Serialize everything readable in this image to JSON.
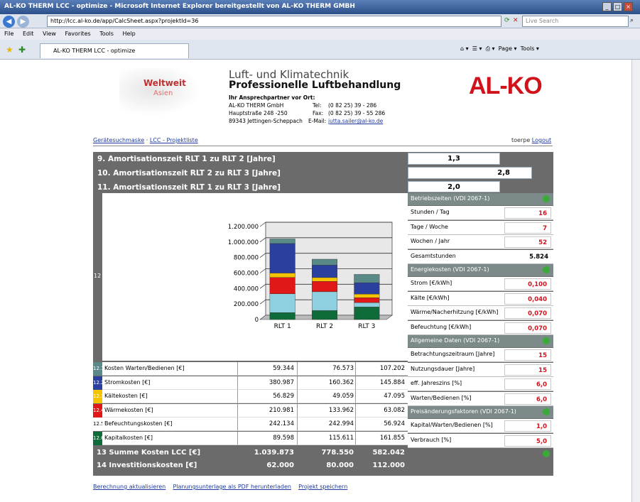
{
  "window": {
    "title": "AL-KO THERM LCC - optimize - Microsoft Internet Explorer bereitgestellt von AL-KO THERM GMBH"
  },
  "browser": {
    "url": "http://lcc.al-ko.de/app/CalcSheet.aspx?projektId=36",
    "search_placeholder": "Live Search",
    "menu": [
      "File",
      "Edit",
      "View",
      "Favorites",
      "Tools",
      "Help"
    ],
    "tab_label": "AL-KO THERM LCC - optimize",
    "toolbar": [
      "Page",
      "Tools"
    ]
  },
  "header": {
    "map_title": "Weltweit",
    "map_sub": "Asien",
    "tagline1": "Luft- und Klimatechnik",
    "tagline2": "Professionelle Luftbehandlung",
    "contact_heading": "Ihr Ansprechpartner vor Ort:",
    "company": "AL-KO THERM GmbH",
    "street": "Hauptstraße 248 -250",
    "city": "89343 Jettingen-Scheppach",
    "tel_label": "Tel:",
    "tel": "(0 82 25) 39 - 286",
    "fax_label": "Fax:",
    "fax": "(0 82 25) 39 - 55 286",
    "email_label": "E-Mail:",
    "email": "jutta.sailer@al-ko.de",
    "logo": "AL-KO"
  },
  "nav": {
    "link1": "Gerätesuchmaske",
    "sep": "·",
    "link2": "LCC - Projektliste",
    "user": "toerpe",
    "logout": "Logout"
  },
  "rows": {
    "r9": {
      "label": "9.   Amortisationszeit RLT 1 zu RLT 2 [Jahre]",
      "value": "1,3"
    },
    "r10": {
      "label": "10.  Amortisationszeit RLT 2 zu RLT 3 [Jahre]",
      "value": "2,8"
    },
    "r11": {
      "label": "11.  Amortisationszeit RLT 1 zu RLT 3 [Jahre]",
      "value": "2,0"
    },
    "r12_num": "12"
  },
  "chart_data": {
    "type": "bar",
    "stacked": true,
    "categories": [
      "RLT 1",
      "RLT 2",
      "RLT 3"
    ],
    "ylim": [
      0,
      1200000
    ],
    "yticks": [
      "0",
      "200.000",
      "400.000",
      "600.000",
      "800.000",
      "1.000.000",
      "1.200.000"
    ],
    "grid": true,
    "series": [
      {
        "color": "#0f6b3a",
        "values": [
          89598,
          115611,
          161855
        ]
      },
      {
        "color": "#8fd0e0",
        "values": [
          242134,
          242994,
          56924
        ]
      },
      {
        "color": "#e01818",
        "values": [
          210981,
          133962,
          63082
        ]
      },
      {
        "color": "#f4c400",
        "values": [
          56829,
          49059,
          47095
        ]
      },
      {
        "color": "#2a3f9e",
        "values": [
          380987,
          160362,
          145884
        ]
      },
      {
        "color": "#5a8a88",
        "values": [
          59344,
          76573,
          107202
        ]
      }
    ]
  },
  "cost_table": {
    "rows": [
      {
        "num": "12.1",
        "label": "Kosten Warten/Bedienen [€]",
        "color": "#5a8a88",
        "v": [
          "59.344",
          "76.573",
          "107.202"
        ]
      },
      {
        "num": "12.2",
        "label": "Stromkosten [€]",
        "color": "#2a3f9e",
        "v": [
          "380.987",
          "160.362",
          "145.884"
        ]
      },
      {
        "num": "12.3",
        "label": "Kältekosten [€]",
        "color": "#f4c400",
        "v": [
          "56.829",
          "49.059",
          "47.095"
        ]
      },
      {
        "num": "12.4",
        "label": "Wärmekosten [€]",
        "color": "#e01818",
        "v": [
          "210.981",
          "133.962",
          "63.082"
        ]
      },
      {
        "num": "12.5",
        "label": "Befeuchtungskosten [€]",
        "color": "#ffffff",
        "v": [
          "242.134",
          "242.994",
          "56.924"
        ]
      },
      {
        "num": "12.6",
        "label": "Kapitalkosten [€]",
        "color": "#0f6b3a",
        "v": [
          "89.598",
          "115.611",
          "161.855"
        ]
      }
    ],
    "sum": {
      "label": "13   Summe Kosten LCC [€]",
      "v": [
        "1.039.873",
        "778.550",
        "582.042"
      ]
    },
    "inv": {
      "label": "14   Investitionskosten [€]",
      "v": [
        "62.000",
        "80.000",
        "112.000"
      ]
    }
  },
  "side": {
    "sec1": "Betriebszeiten (VDI 2067-1)",
    "s1": [
      {
        "label": "Stunden / Tag",
        "value": "16"
      },
      {
        "label": "Tage / Woche",
        "value": "7"
      },
      {
        "label": "Wochen / Jahr",
        "value": "52"
      }
    ],
    "gesamt_label": "Gesamtstunden",
    "gesamt": "5.824",
    "sec2": "Energiekosten (VDI 2067-1)",
    "s2": [
      {
        "label": "Strom [€/kWh]",
        "value": "0,100"
      },
      {
        "label": "Kälte [€/kWh]",
        "value": "0,040"
      },
      {
        "label": "Wärme/Nacherhitzung [€/kWh]",
        "value": "0,070"
      },
      {
        "label": "Befeuchtung [€/kWh]",
        "value": "0,070"
      }
    ],
    "sec3": "Allgemeine Daten (VDI 2067-1)",
    "s3": [
      {
        "label": "Betrachtungszeitraum [Jahre]",
        "value": "15"
      },
      {
        "label": "Nutzungsdauer [Jahre]",
        "value": "15"
      },
      {
        "label": "eff. Jahreszins [%]",
        "value": "6,0"
      },
      {
        "label": "Warten/Bedienen [%]",
        "value": "6,0"
      }
    ],
    "sec4": "Preisänderungsfaktoren (VDI 2067-1)",
    "s4": [
      {
        "label": "Kapital/Warten/Bedienen [%]",
        "value": "1,0"
      },
      {
        "label": "Verbrauch [%]",
        "value": "5,0"
      }
    ]
  },
  "footer": {
    "l1": "Berechnung aktualisieren",
    "l2": "Planungsunterlage als PDF herunterladen",
    "l3": "Projekt speichern"
  }
}
